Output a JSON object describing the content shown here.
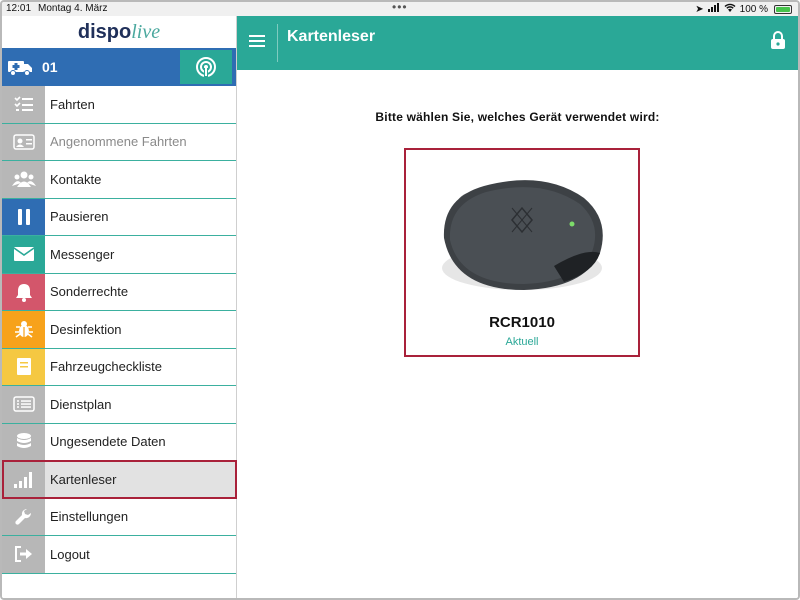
{
  "status_bar": {
    "time": "12:01",
    "date": "Montag 4. März",
    "battery": "100 %"
  },
  "app": {
    "logo_part1": "dispo",
    "logo_part2": "live",
    "vehicle_number": "01"
  },
  "sidebar": {
    "items": [
      {
        "label": "Fahrten",
        "icon": "checklist-icon",
        "icon_bg": "#b7b7b7",
        "disabled": false
      },
      {
        "label": "Angenommene Fahrten",
        "icon": "id-card-icon",
        "icon_bg": "#b7b7b7",
        "disabled": true
      },
      {
        "label": "Kontakte",
        "icon": "users-icon",
        "icon_bg": "#b7b7b7",
        "disabled": false
      },
      {
        "label": "Pausieren",
        "icon": "pause-icon",
        "icon_bg": "#2f6db3",
        "disabled": false
      },
      {
        "label": "Messenger",
        "icon": "envelope-icon",
        "icon_bg": "#2aa897",
        "disabled": false
      },
      {
        "label": "Sonderrechte",
        "icon": "bell-icon",
        "icon_bg": "#d3566b",
        "disabled": false
      },
      {
        "label": "Desinfektion",
        "icon": "bug-icon",
        "icon_bg": "#f7a21b",
        "disabled": false
      },
      {
        "label": "Fahrzeugcheckliste",
        "icon": "book-icon",
        "icon_bg": "#f5c842",
        "disabled": false
      },
      {
        "label": "Dienstplan",
        "icon": "list-icon",
        "icon_bg": "#b7b7b7",
        "disabled": false
      },
      {
        "label": "Ungesendete Daten",
        "icon": "database-icon",
        "icon_bg": "#b7b7b7",
        "disabled": false
      },
      {
        "label": "Kartenleser",
        "icon": "signal-bars-icon",
        "icon_bg": "#b7b7b7",
        "disabled": false
      },
      {
        "label": "Einstellungen",
        "icon": "wrench-icon",
        "icon_bg": "#b7b7b7",
        "disabled": false
      },
      {
        "label": "Logout",
        "icon": "logout-icon",
        "icon_bg": "#b7b7b7",
        "disabled": false
      }
    ]
  },
  "header": {
    "title": "Kartenleser"
  },
  "main": {
    "prompt": "Bitte wählen Sie, welches Gerät verwendet wird:",
    "device": {
      "name": "RCR1010",
      "status": "Aktuell"
    }
  },
  "colors": {
    "accent": "#2aa897",
    "primary_blue": "#2f6db3",
    "selection_border": "#a9213a"
  }
}
